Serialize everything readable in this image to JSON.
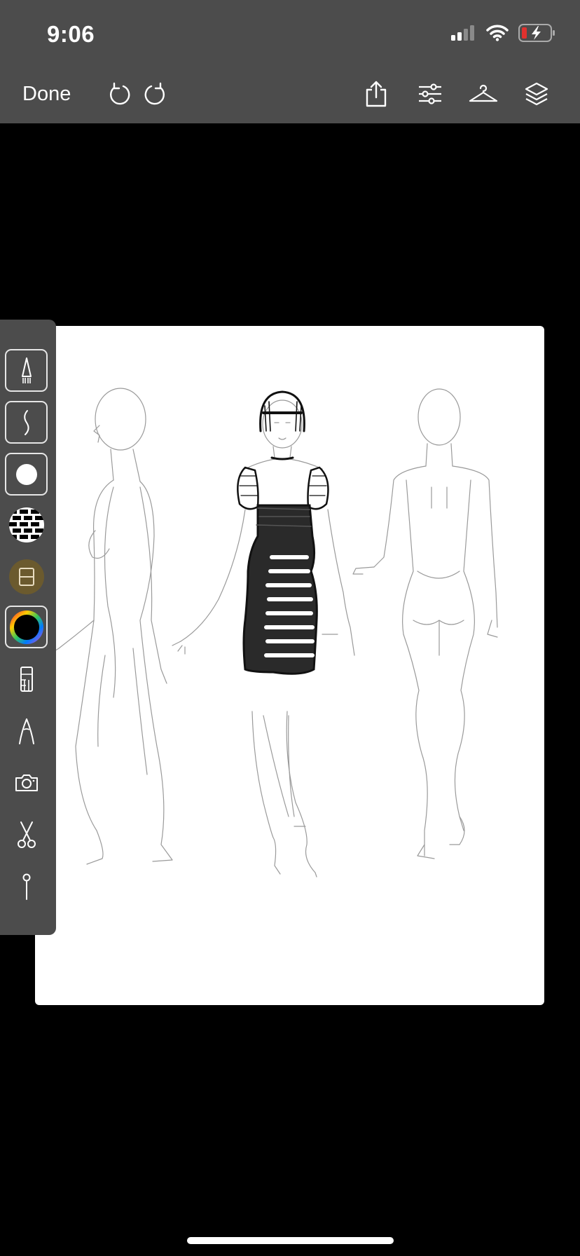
{
  "status_bar": {
    "time": "9:06",
    "icons": [
      "signal-icon",
      "wifi-icon",
      "battery-charging-icon"
    ]
  },
  "toolbar": {
    "done_label": "Done",
    "left_icons": [
      "undo-icon",
      "redo-icon"
    ],
    "right_icons": [
      "share-icon",
      "adjustments-icon",
      "hanger-icon",
      "layers-icon"
    ]
  },
  "palette": {
    "tools": [
      "pencil-brush-tool",
      "stroke-tool",
      "brush-size-tool",
      "pattern-fill-tool",
      "swatch-tool",
      "color-wheel-tool",
      "ruler-tool",
      "compass-tool",
      "camera-tool",
      "scissors-tool",
      "pin-tool"
    ],
    "swatch_color": "#6b5a2e"
  },
  "canvas": {
    "content": "fashion-croquis-sketch",
    "background": "#ffffff"
  },
  "colors": {
    "chrome": "#4c4c4c",
    "background": "#000000",
    "battery_low": "#e0312e"
  }
}
